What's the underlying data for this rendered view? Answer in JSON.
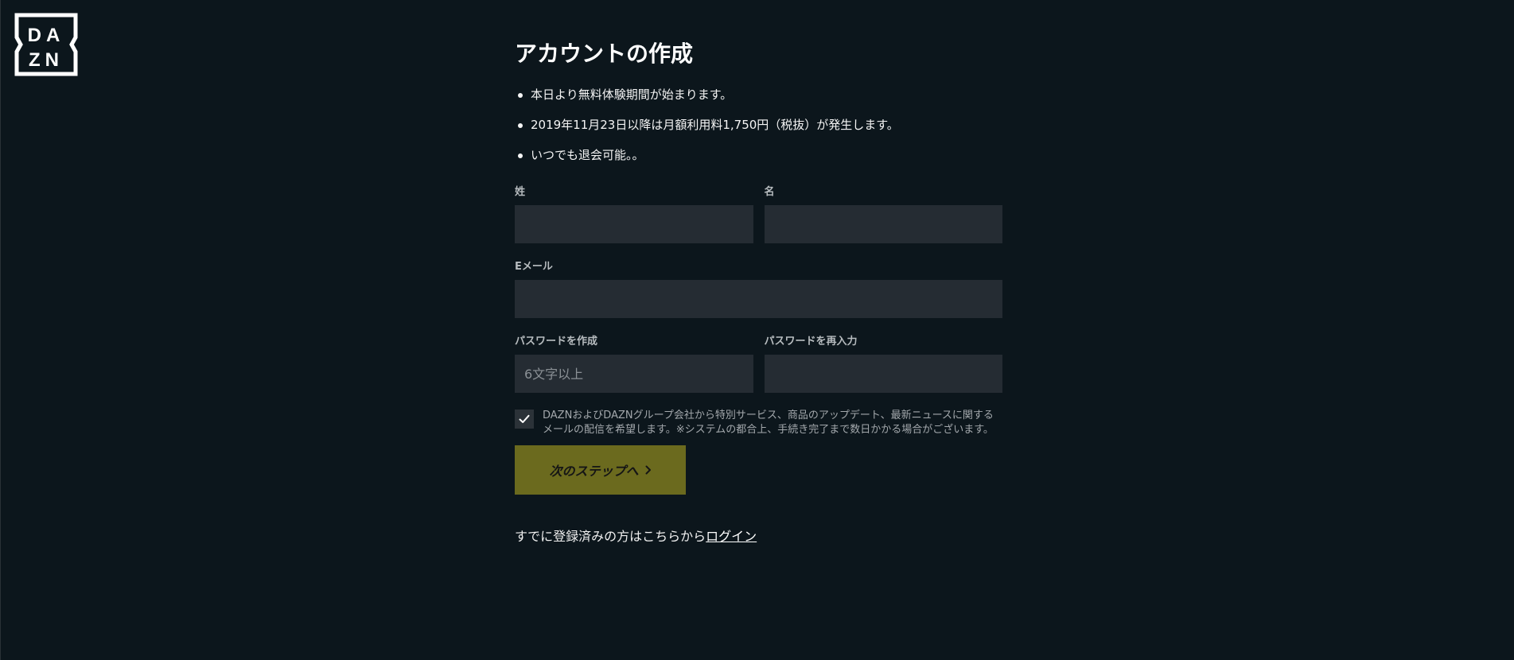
{
  "brand": {
    "logo_line1": "DA",
    "logo_line2": "ZN"
  },
  "page": {
    "title": "アカウントの作成",
    "bullets": [
      "本日より無料体験期間が始まります。",
      "2019年11月23日以降は月額利用料1,750円（税抜）が発生します。",
      "いつでも退会可能。。"
    ]
  },
  "form": {
    "last_name": {
      "label": "姓",
      "value": "",
      "placeholder": ""
    },
    "first_name": {
      "label": "名",
      "value": "",
      "placeholder": ""
    },
    "email": {
      "label": "Eメール",
      "value": "",
      "placeholder": ""
    },
    "password": {
      "label": "パスワードを作成",
      "value": "",
      "placeholder": "6文字以上"
    },
    "password_confirm": {
      "label": "パスワードを再入力",
      "value": "",
      "placeholder": ""
    },
    "consent": {
      "checked": true,
      "text": "DAZNおよびDAZNグループ会社から特別サービス、商品のアップデート、最新ニュースに関するメールの配信を希望します。※システムの都合上、手続き完了まで数日かかる場合がございます。"
    },
    "next_button": "次のステップへ"
  },
  "login": {
    "prompt": "すでに登録済みの方はこちらから",
    "link": "ログイン"
  },
  "colors": {
    "background": "#0c161c",
    "input_bg": "#252c33",
    "button_bg": "#6b6a1e"
  },
  "icons": {
    "checkbox": "checkmark-icon",
    "button": "chevron-right-icon"
  }
}
